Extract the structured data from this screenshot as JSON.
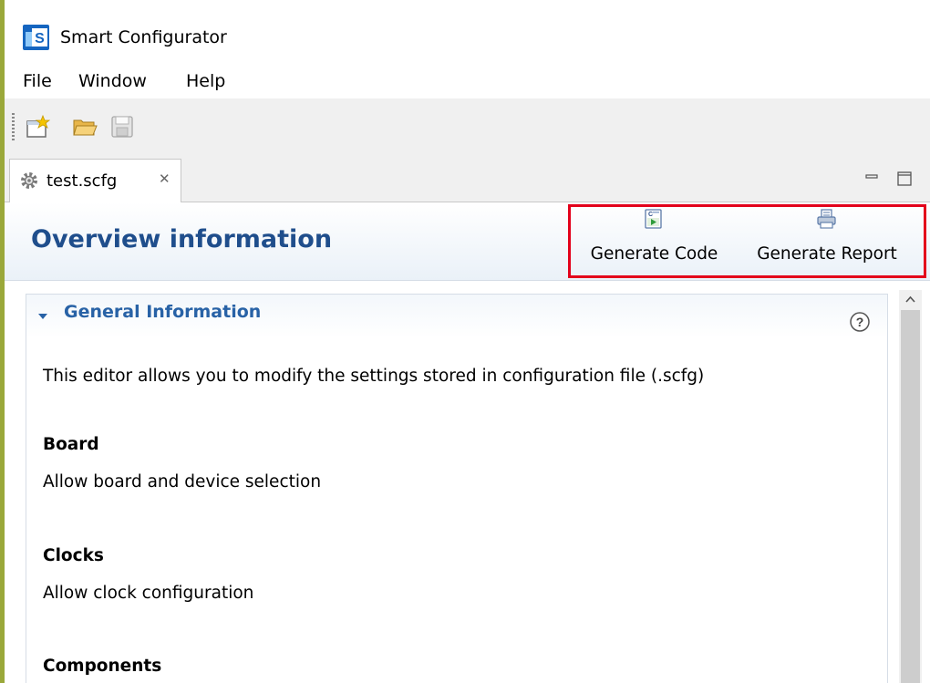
{
  "window": {
    "title": "Smart Configurator",
    "logo_text": "S"
  },
  "menu": {
    "items": [
      "File",
      "Window",
      "Help"
    ]
  },
  "toolbar": {
    "icons": [
      "new-file-icon",
      "open-folder-icon",
      "save-icon"
    ]
  },
  "tab": {
    "label": "test.scfg",
    "close_glyph": "✕"
  },
  "header": {
    "title": "Overview information",
    "actions": [
      {
        "label": "Generate Code",
        "icon": "generate-code-icon"
      },
      {
        "label": "Generate Report",
        "icon": "generate-report-icon"
      }
    ]
  },
  "general_info": {
    "title": "General Information",
    "description": "This editor allows you to modify the settings stored in configuration file (.scfg)",
    "items": [
      {
        "heading": "Board",
        "text": "Allow board and device selection"
      },
      {
        "heading": "Clocks",
        "text": "Allow clock configuration"
      },
      {
        "heading": "Components",
        "text": ""
      }
    ]
  },
  "colors": {
    "title_blue": "#1f4e8c",
    "section_blue": "#2862a6",
    "highlight_red": "#e3001b",
    "toolbar_gray": "#f0f0f0"
  }
}
